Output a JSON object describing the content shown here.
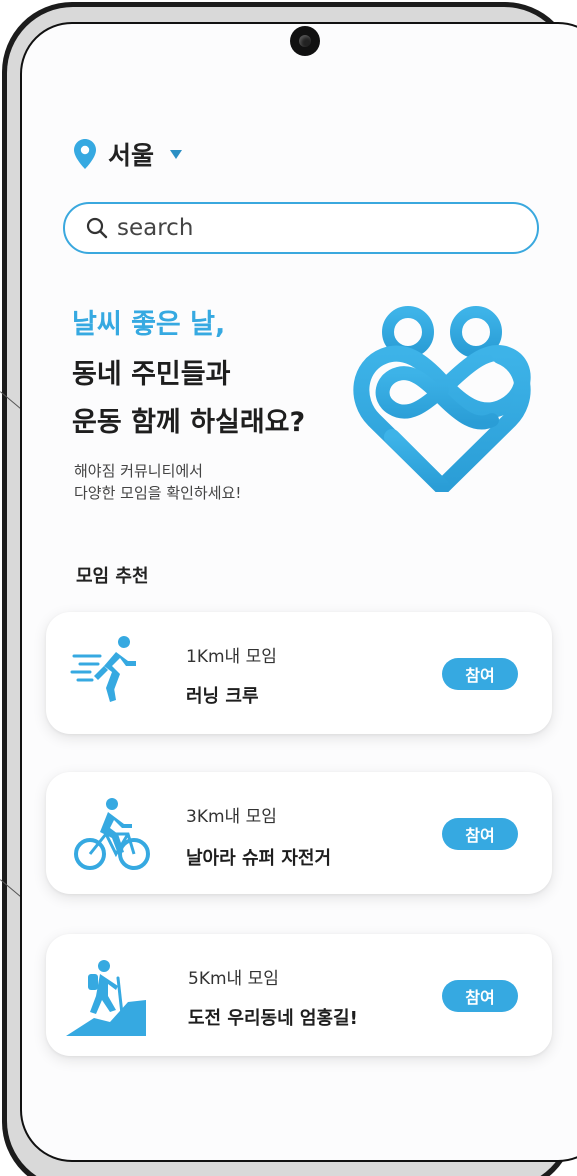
{
  "location": {
    "label": "서울",
    "pin_icon": "location-pin-icon",
    "caret_icon": "caret-down-icon"
  },
  "search": {
    "placeholder": "search",
    "icon": "search-icon"
  },
  "hero": {
    "line1": "날씨 좋은 날,",
    "line2": "동네 주민들과",
    "line3": "운동 함께 하실래요?",
    "sub1": "해야짐 커뮤니티에서",
    "sub2": "다양한 모임을 확인하세요!",
    "logo_icon": "infinity-heart-logo"
  },
  "section": {
    "title": "모임 추천"
  },
  "meetups": [
    {
      "distance": "1Km내 모임",
      "name": "러닝 크루",
      "join_label": "참여",
      "icon": "runner-icon"
    },
    {
      "distance": "3Km내 모임",
      "name": "날아라 슈퍼 자전거",
      "join_label": "참여",
      "icon": "cyclist-icon"
    },
    {
      "distance": "5Km내 모임",
      "name": "도전 우리동네 엄홍길!",
      "join_label": "참여",
      "icon": "hiker-icon"
    }
  ],
  "colors": {
    "accent": "#36a9e1",
    "text": "#1e1e1e",
    "card_bg": "#ffffff"
  }
}
